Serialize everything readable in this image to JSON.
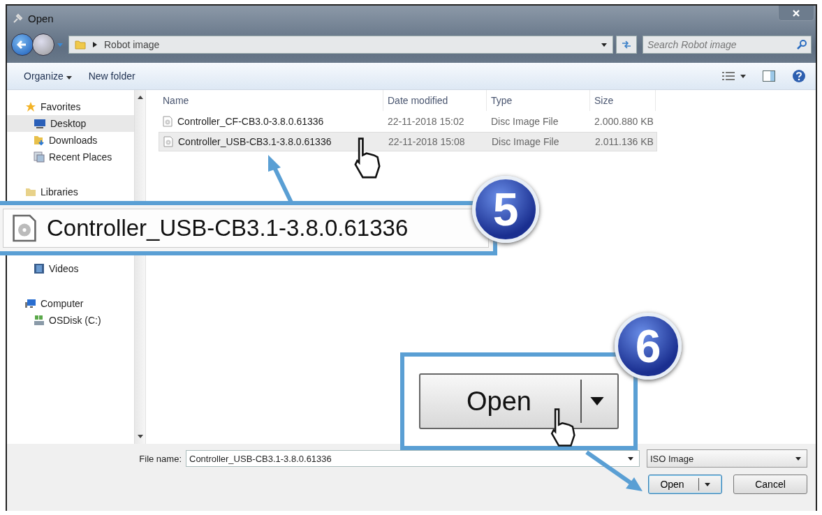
{
  "window": {
    "title": "Open"
  },
  "address": {
    "path": "Robot image",
    "search_placeholder": "Search Robot image"
  },
  "toolbar": {
    "organize": "Organize",
    "new_folder": "New folder"
  },
  "sidebar": {
    "groups": [
      {
        "label": "Favorites",
        "kind": "star",
        "children": [
          {
            "label": "Desktop",
            "kind": "desktop",
            "selected": true
          },
          {
            "label": "Downloads",
            "kind": "downloads",
            "selected": false
          },
          {
            "label": "Recent Places",
            "kind": "recent",
            "selected": false
          }
        ]
      },
      {
        "label": "Libraries",
        "kind": "library",
        "children": [
          {
            "label": "Videos",
            "kind": "videos",
            "selected": false
          }
        ]
      },
      {
        "label": "Computer",
        "kind": "computer",
        "children": [
          {
            "label": "OSDisk (C:)",
            "kind": "disk",
            "selected": false
          }
        ]
      }
    ]
  },
  "files": {
    "columns": [
      "Name",
      "Date modified",
      "Type",
      "Size"
    ],
    "rows": [
      {
        "name": "Controller_CF-CB3.0-3.8.0.61336",
        "date": "22-11-2018 15:02",
        "type": "Disc Image File",
        "size": "2.000.880 KB",
        "selected": false
      },
      {
        "name": "Controller_USB-CB3.1-3.8.0.61336",
        "date": "22-11-2018 15:08",
        "type": "Disc Image File",
        "size": "2.011.136 KB",
        "selected": true
      }
    ]
  },
  "footer": {
    "file_name_label": "File name:",
    "file_name": "Controller_USB-CB3.1-3.8.0.61336",
    "file_type": "ISO Image",
    "open": "Open",
    "cancel": "Cancel"
  },
  "callouts": [
    {
      "number": "5",
      "text": "Controller_USB-CB3.1-3.8.0.61336"
    },
    {
      "number": "6",
      "button": "Open"
    }
  ]
}
